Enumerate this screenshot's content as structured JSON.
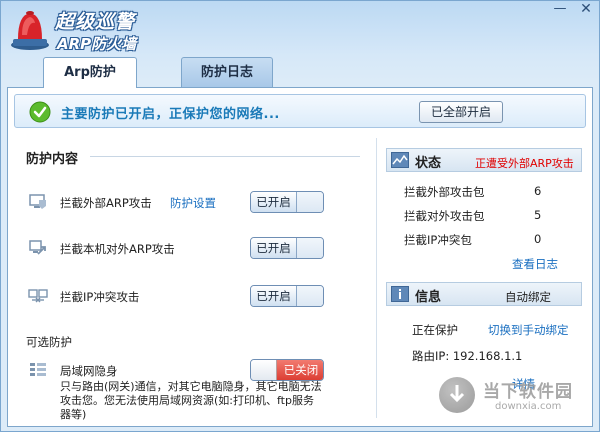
{
  "header": {
    "title": "超级巡警",
    "subtitle": "ARP防火墙",
    "minimize_glyph": "—",
    "close_glyph": "✕"
  },
  "tabs": [
    {
      "label": "Arp防护",
      "active": true
    },
    {
      "label": "防护日志",
      "active": false
    }
  ],
  "banner": {
    "status_text": "主要防护已开启，正保护您的网络...",
    "enable_all_label": "已全部开启",
    "status_color": "#1a7ab8"
  },
  "protection": {
    "section_title": "防护内容",
    "items": [
      {
        "label": "拦截外部ARP攻击",
        "link": "防护设置",
        "toggle": "已开启",
        "state": "on",
        "icon": "shield-monitor-icon"
      },
      {
        "label": "拦截本机对外ARP攻击",
        "link": "",
        "toggle": "已开启",
        "state": "on",
        "icon": "outbound-arrow-icon"
      },
      {
        "label": "拦截IP冲突攻击",
        "link": "",
        "toggle": "已开启",
        "state": "on",
        "icon": "ip-conflict-icon"
      }
    ],
    "optional_title": "可选防护",
    "optional_item": {
      "label": "局域网隐身",
      "toggle": "已关闭",
      "state": "off",
      "icon": "lan-stealth-icon"
    },
    "optional_desc": "只与路由(网关)通信，对其它电脑隐身，其它电脑无法攻击您。您无法使用局域网资源(如:打印机、ftp服务器等)"
  },
  "status_panel": {
    "title": "状态",
    "alert": "正遭受外部ARP攻击",
    "alert_color": "#e00000",
    "stats": [
      {
        "label": "拦截外部攻击包",
        "value": "6"
      },
      {
        "label": "拦截对外攻击包",
        "value": "5"
      },
      {
        "label": "拦截IP冲突包",
        "value": "0"
      }
    ],
    "view_log": "查看日志"
  },
  "info_panel": {
    "title": "信息",
    "mode": "自动绑定",
    "protecting_label": "正在保护",
    "switch_link": "切换到手动绑定",
    "router_label": "路由IP: 192.168.1.1",
    "details_link": "详情"
  },
  "watermark": {
    "name": "当下软件园",
    "url": "downxia.com"
  }
}
